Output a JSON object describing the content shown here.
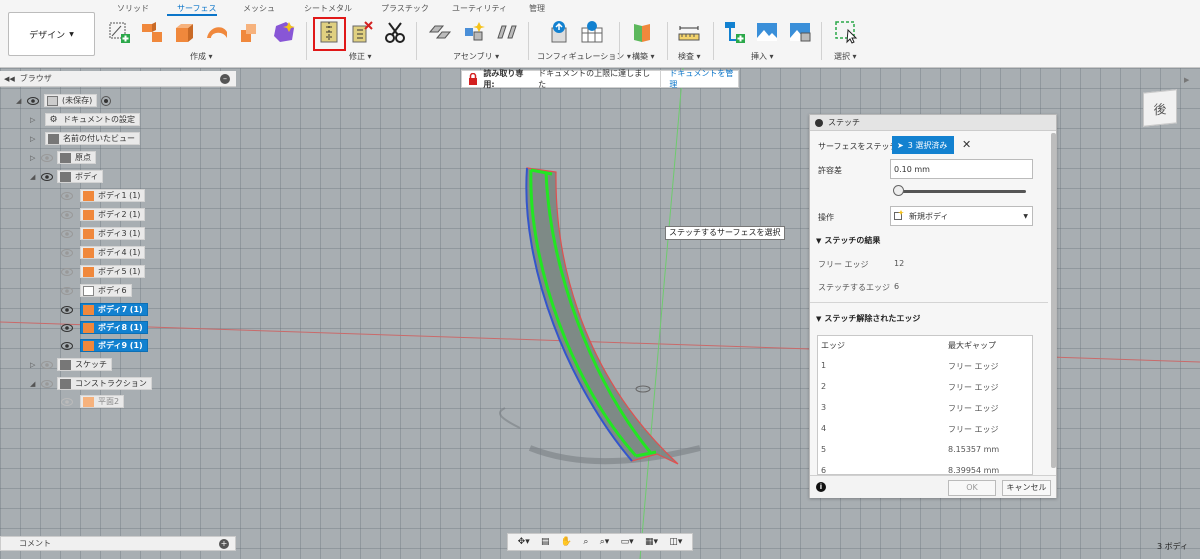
{
  "toolbar": {
    "design_label": "デザイン",
    "tabs": [
      "ソリッド",
      "サーフェス",
      "メッシュ",
      "シートメタル",
      "プラスチック",
      "ユーティリティ",
      "管理"
    ],
    "groups": [
      "作成 ▾",
      "修正 ▾",
      "アセンブリ ▾",
      "コンフィギュレーション ▾",
      "構築 ▾",
      "検査 ▾",
      "挿入 ▾",
      "選択 ▾"
    ]
  },
  "browser": {
    "title": "ブラウザ",
    "items": [
      {
        "label": "(未保存)"
      },
      {
        "label": "ドキュメントの設定"
      },
      {
        "label": "名前の付いたビュー"
      },
      {
        "label": "原点"
      },
      {
        "label": "ボディ"
      },
      {
        "label": "ボディ1 (1)"
      },
      {
        "label": "ボディ2 (1)"
      },
      {
        "label": "ボディ3 (1)"
      },
      {
        "label": "ボディ4 (1)"
      },
      {
        "label": "ボディ5 (1)"
      },
      {
        "label": "ボディ6"
      },
      {
        "label": "ボディ7 (1)"
      },
      {
        "label": "ボディ8 (1)"
      },
      {
        "label": "ボディ9 (1)"
      },
      {
        "label": "スケッチ"
      },
      {
        "label": "コンストラクション"
      },
      {
        "label": "平面2"
      }
    ]
  },
  "readonly": {
    "label": "読み取り専用:",
    "message": "ドキュメントの上限に達しました",
    "manage": "ドキュメントを管理"
  },
  "tooltip": "ステッチするサーフェスを選択",
  "stitch": {
    "title": "ステッチ",
    "surfaces_label": "サーフェスをステッチ",
    "selected": "3 選択済み",
    "tolerance_label": "許容差",
    "tolerance_value": "0.10 mm",
    "operation_label": "操作",
    "operation_value": "新規ボディ",
    "results_header": "ステッチの結果",
    "free_edges_label": "フリー エッジ",
    "free_edges_value": "12",
    "stitch_edges_label": "ステッチするエッジ",
    "stitch_edges_value": "6",
    "unstitched_header": "ステッチ解除されたエッジ",
    "table_headers": [
      "エッジ",
      "最大ギャップ"
    ],
    "table_rows": [
      [
        "1",
        "フリー エッジ"
      ],
      [
        "2",
        "フリー エッジ"
      ],
      [
        "3",
        "フリー エッジ"
      ],
      [
        "4",
        "フリー エッジ"
      ],
      [
        "5",
        "8.15357 mm"
      ],
      [
        "6",
        "8.39954 mm"
      ]
    ],
    "ok": "OK",
    "cancel": "キャンセル"
  },
  "viewcube_label": "後",
  "comment_label": "コメント",
  "status": "3 ボディ",
  "colors": {
    "accent": "#0b75c9",
    "selection": "#1281d0",
    "highlight": "#e01818",
    "edge_green": "#22e622"
  }
}
